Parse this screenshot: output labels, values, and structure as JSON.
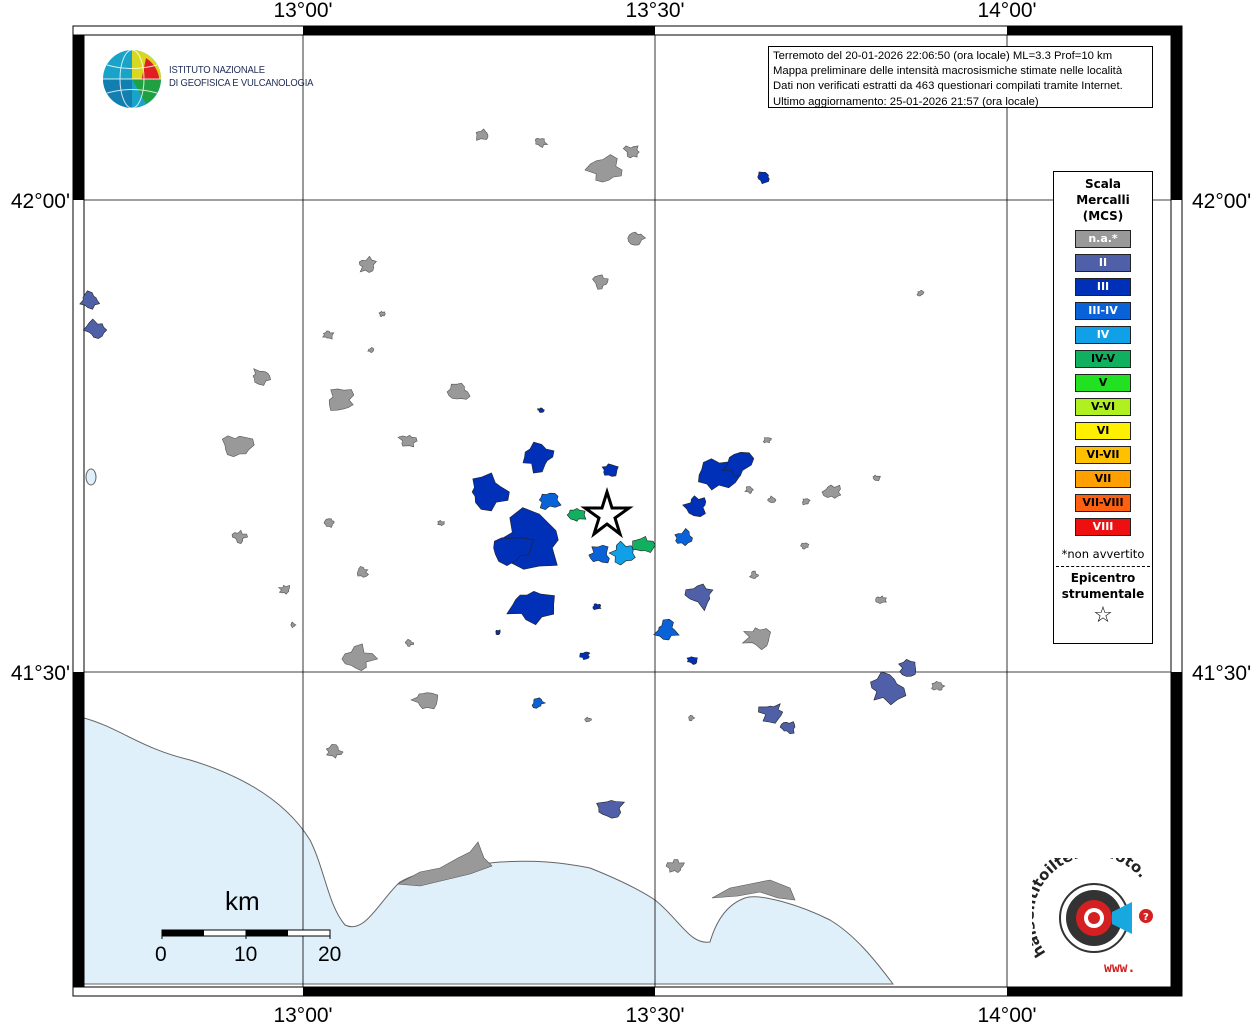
{
  "map": {
    "lon_ticks": [
      "13°00'",
      "13°30'",
      "14°00'"
    ],
    "lat_ticks": [
      "42°00'",
      "41°30'"
    ],
    "epicenter": {
      "symbol": "star"
    },
    "colors": {
      "sea": "#dff0fb",
      "land": "#ffffff",
      "na": "#999999",
      "II": "#5060a8",
      "III": "#0030b8",
      "III-IV": "#0a62d8",
      "IV": "#10a0e8",
      "IV-V": "#10b060"
    }
  },
  "logo": {
    "line1": "ISTITUTO NAZIONALE",
    "line2": "DI GEOFISICA E VULCANOLOGIA"
  },
  "info": {
    "line1": "Terremoto del 20-01-2026 22:06:50 (ora locale) ML=3.3 Prof=10 km",
    "line2": "Mappa preliminare delle intensità macrosismiche stimate nelle località",
    "line3": "Dati non verificati estratti da 463 questionari compilati tramite Internet.",
    "line4": "Ultimo aggiornamento: 25-01-2026 21:57 (ora locale)"
  },
  "legend": {
    "title": "Scala\nMercalli\n(MCS)",
    "items": [
      {
        "label": "n.a.*",
        "color": "#999999",
        "text_color": "#ffffff"
      },
      {
        "label": "II",
        "color": "#5060a8",
        "text_color": "#ffffff"
      },
      {
        "label": "III",
        "color": "#0030b8",
        "text_color": "#ffffff"
      },
      {
        "label": "III-IV",
        "color": "#0a62d8",
        "text_color": "#ffffff"
      },
      {
        "label": "IV",
        "color": "#10a0e8",
        "text_color": "#ffffff"
      },
      {
        "label": "IV-V",
        "color": "#10b060",
        "text_color": "#000000"
      },
      {
        "label": "V",
        "color": "#22e022",
        "text_color": "#000000"
      },
      {
        "label": "V-VI",
        "color": "#b0f020",
        "text_color": "#000000"
      },
      {
        "label": "VI",
        "color": "#fff000",
        "text_color": "#000000"
      },
      {
        "label": "VI-VII",
        "color": "#ffc000",
        "text_color": "#000000"
      },
      {
        "label": "VII",
        "color": "#ffa000",
        "text_color": "#000000"
      },
      {
        "label": "VII-VIII",
        "color": "#ff6010",
        "text_color": "#000000"
      },
      {
        "label": "VIII",
        "color": "#ee1010",
        "text_color": "#ffffff"
      }
    ],
    "note": "*non avvertito",
    "epicenter_label": "Epicentro\nstrumentale",
    "epicenter_symbol": "☆"
  },
  "scalebar": {
    "unit": "km",
    "labels": [
      "0",
      "10",
      "20"
    ]
  },
  "watermark": {
    "text": "haisentitoilterremoto.it",
    "url": "www."
  }
}
